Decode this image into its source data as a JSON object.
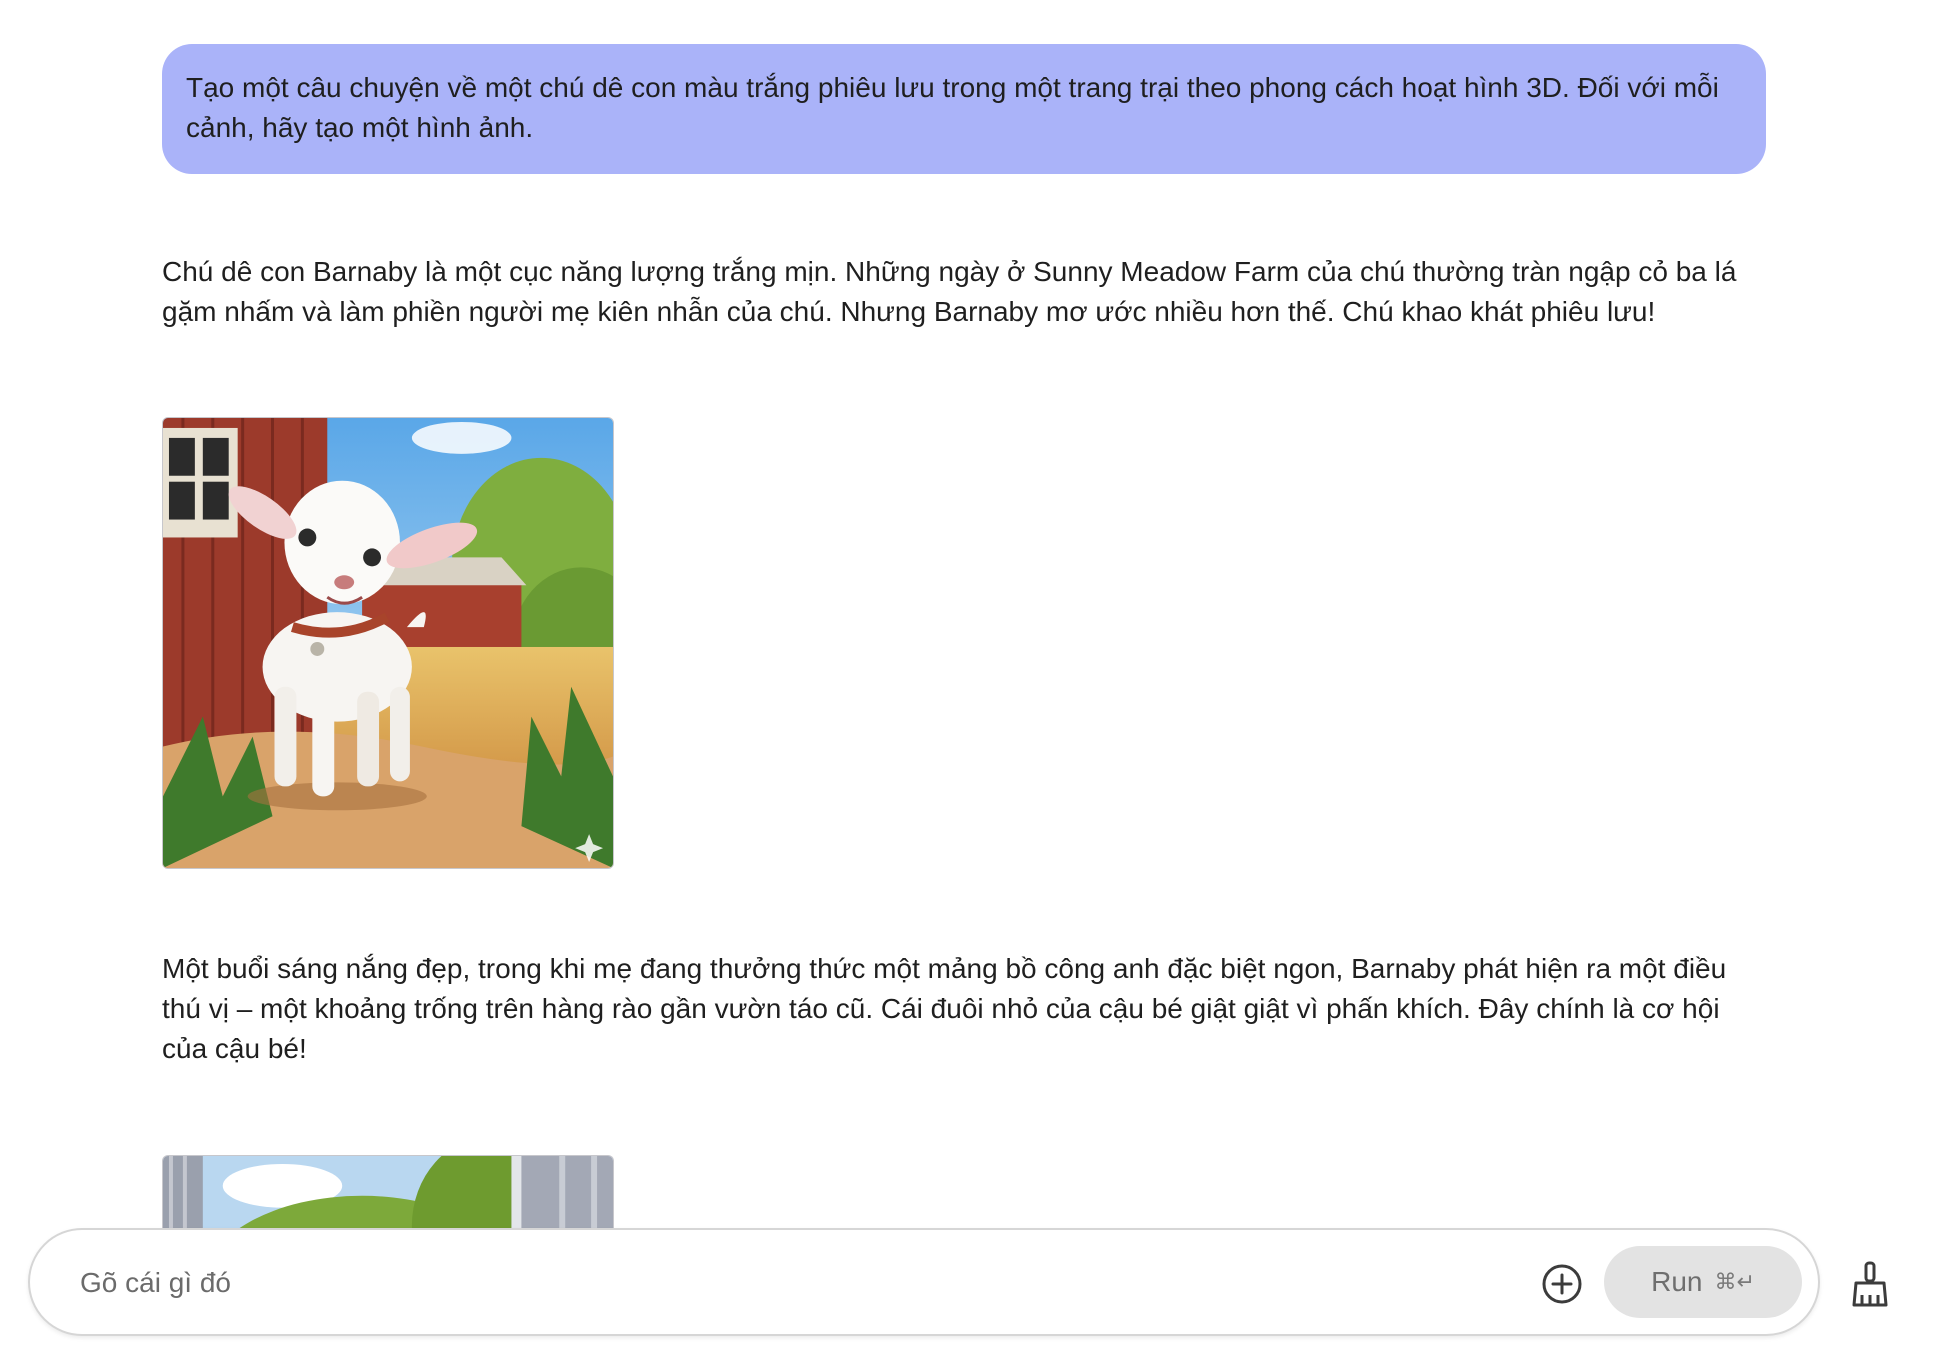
{
  "conversation": {
    "user_prompt": "Tạo một câu chuyện về một chú dê con màu trắng phiêu lưu trong một trang trại theo phong cách hoạt hình 3D. Đối với mỗi cảnh, hãy tạo một hình ảnh.",
    "paragraphs": [
      "Chú dê con Barnaby là một cục năng lượng trắng mịn. Những ngày ở Sunny Meadow Farm của chú thường tràn ngập cỏ ba lá gặm nhấm và làm phiền người mẹ kiên nhẫn của chú. Nhưng Barnaby mơ ước nhiều hơn thế. Chú khao khát phiêu lưu!",
      "Một buổi sáng nắng đẹp, trong khi mẹ đang thưởng thức một mảng bồ công anh đặc biệt ngon, Barnaby phát hiện ra một điều thú vị – một khoảng trống trên hàng rào gần vườn táo cũ. Cái đuôi nhỏ của cậu bé giật giật vì phấn khích. Đây chính là cơ hội của cậu bé!"
    ]
  },
  "composer": {
    "placeholder": "Gõ cái gì đó",
    "value": "",
    "run_label": "Run",
    "run_shortcut": "⌘↵"
  },
  "icons": {
    "add": "add-circle-icon",
    "clear": "broom-icon",
    "image_badge": "sparkle-icon"
  },
  "colors": {
    "prompt_bubble": "#aab3f9",
    "run_button_bg": "#e3e3e3",
    "text": "#1f1f1f"
  }
}
